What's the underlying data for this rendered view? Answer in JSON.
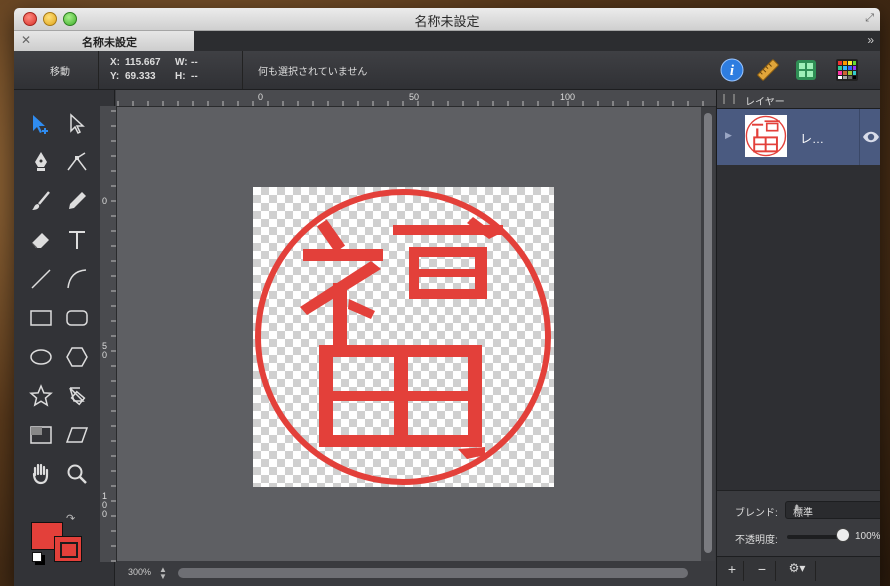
{
  "window": {
    "title": "名称未設定"
  },
  "tab": {
    "label": "名称未設定",
    "close_glyph": "✕",
    "more_glyph": "»"
  },
  "infobar": {
    "mode": "移動",
    "x_label": "X:",
    "x_value": "115.667",
    "y_label": "Y:",
    "y_value": "69.333",
    "w_label": "W:",
    "w_value": "--",
    "h_label": "H:",
    "h_value": "--",
    "status": "何も選択されていません"
  },
  "toolbar_icons": [
    "info-icon",
    "ruler-icon",
    "grid-view-icon",
    "color-palette-icon"
  ],
  "tools": [
    "select-add-tool",
    "direct-select-tool",
    "pen-tool",
    "node-tool",
    "brush-tool",
    "pencil-tool",
    "eraser-tool",
    "text-tool",
    "line-tool",
    "curve-tool",
    "rectangle-tool",
    "rounded-rectangle-tool",
    "ellipse-tool",
    "hexagon-tool",
    "star-tool",
    "transform-tool",
    "crop-tool",
    "skew-tool",
    "hand-tool",
    "zoom-tool"
  ],
  "colors": {
    "fill": "#e3403a",
    "stroke": "#e3403a",
    "accent": "#4a5a80"
  },
  "ruler": {
    "top_labels": [
      "0",
      "50",
      "100"
    ],
    "left_labels": [
      "0",
      "50",
      "100"
    ]
  },
  "artwork": {
    "glyph_top": "畐",
    "glyph_bottom": "田",
    "glyph": "福"
  },
  "zoom": "300%",
  "layers_panel": {
    "title": "レイヤー",
    "layers": [
      {
        "name": "レ…",
        "visible": true
      }
    ]
  },
  "props": {
    "blend_label": "ブレンド:",
    "blend_value": "標準",
    "opacity_label": "不透明度:",
    "opacity_value": "100%",
    "opacity_fraction": 1.0
  },
  "footer": {
    "add": "+",
    "remove": "−",
    "gear": "⚙▾"
  }
}
